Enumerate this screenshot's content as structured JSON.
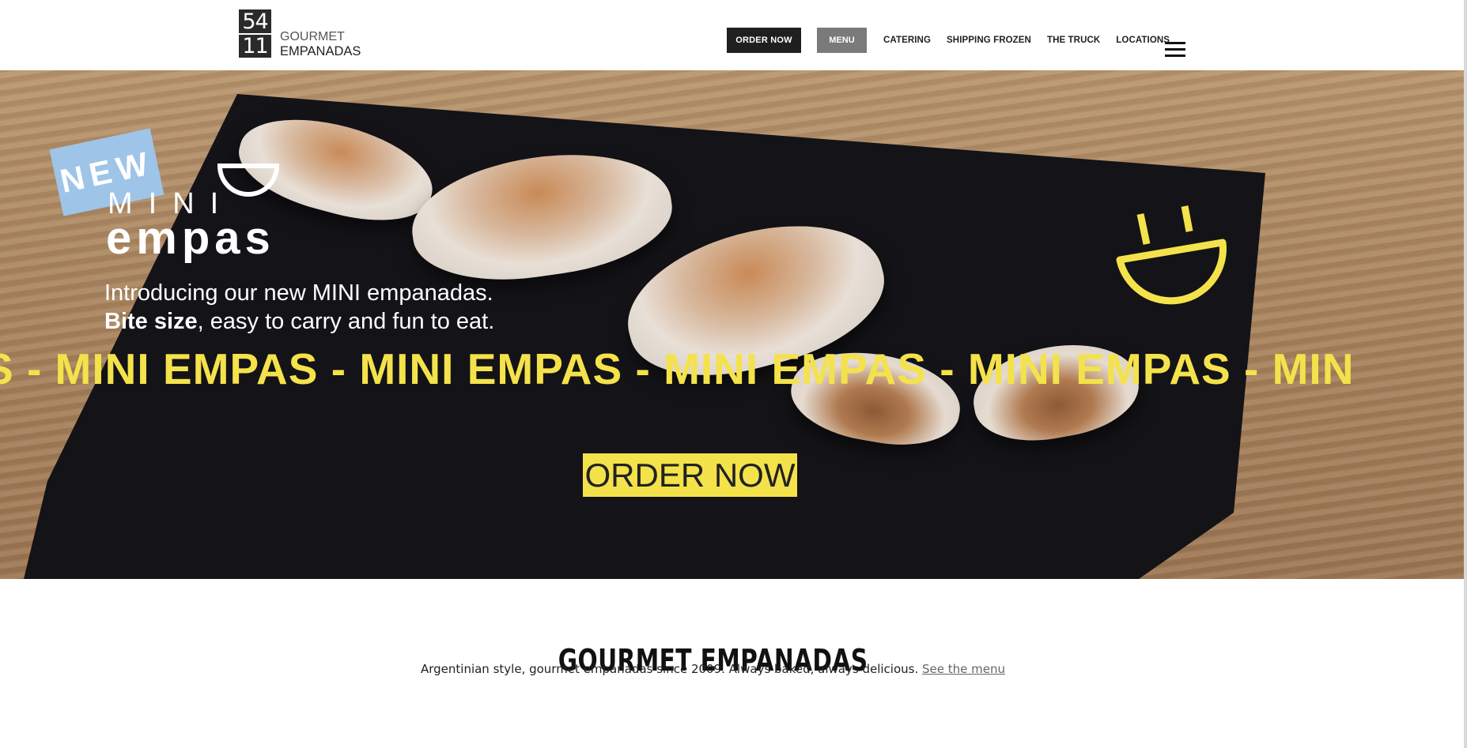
{
  "header": {
    "logo": {
      "num_top": "54",
      "num_bottom": "11",
      "line1": "GOURMET",
      "line2": "EMPANADAS"
    },
    "nav": {
      "order_now": "ORDER NOW",
      "menu": "MENU",
      "links": [
        "CATERING",
        "SHIPPING FROZEN",
        "THE TRUCK",
        "LOCATIONS"
      ]
    }
  },
  "hero": {
    "badge": "NEW",
    "mini": "MINI",
    "empas": "empas",
    "intro_line1": "Introducing our new MINI empanadas.",
    "intro_bold": "Bite size",
    "intro_line2_rest": ", easy to carry and fun to eat.",
    "ticker": "S - MINI EMPAS - MINI EMPAS - MINI EMPAS - MINI EMPAS - MIN",
    "order_button": "ORDER NOW",
    "accent_color": "#f4e24b"
  },
  "content": {
    "title": "GOURMET EMPANADAS",
    "subtitle": "Argentinian style, gourmet empanadas since 2009. Always baked, always delicious.",
    "link": "See the menu"
  }
}
